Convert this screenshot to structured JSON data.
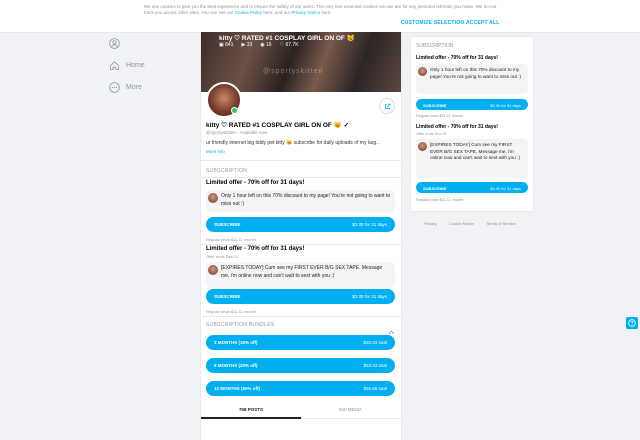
{
  "cookie": {
    "text_before": "We use cookies to give you the best experience and to ensure the safety of our users. The only non-essential cookies we use are for any personal referrals you make. We do not track you across other sites. You can see our ",
    "policy_link": "Cookie Policy",
    "text_mid": " here, and our ",
    "privacy_link": "Privacy Notice",
    "text_after": " here.",
    "customize_label": "CUSTOMIZE SELECTION",
    "accept_label": "ACCEPT ALL"
  },
  "sidebar": {
    "items": [
      {
        "label": "",
        "icon": "user-icon"
      },
      {
        "label": "Home",
        "icon": "home-icon"
      },
      {
        "label": "More",
        "icon": "more-icon"
      }
    ]
  },
  "profile": {
    "cover_title": "kitty ♡ RATED #1 COSPLAY GIRL ON OF 😼",
    "stats": [
      "841",
      "33",
      "16",
      "67.7K"
    ],
    "watermark": "@sportyskitten",
    "name": "kitty ♡ RATED #1 COSPLAY GIRL ON OF 😼 ✓",
    "handle": "@sportyskitten · Available now",
    "bio": "ur friendly internet big tiddy pet kitty 😼 subscribe for daily uploads of my larg..",
    "more_info": "More info"
  },
  "subscription": {
    "label": "SUBSCRIPTION",
    "offers": [
      {
        "title": "Limited offer - 70% off for 31 days!",
        "message": "Only 1 hour left on this 70% discount to my page! You're not going to want to miss out :)",
        "button_label": "SUBSCRIBE",
        "button_price": "$3.30 for 31 days",
        "regular": "Regular price $11.11 /month"
      },
      {
        "title": "Limited offer - 70% off for 31 days!",
        "ends": "Offer ends Dec 21",
        "message": "[EXPIRES TODAY] Cum see my FIRST EVER B/G SEX TAPE. Message me, i'm online now and can't wait to sext with you :)",
        "button_label": "SUBSCRIBE",
        "button_price": "$3.30 for 31 days",
        "regular": "Regular price $11.11 /month"
      }
    ]
  },
  "bundles": {
    "label": "SUBSCRIPTION BUNDLES",
    "items": [
      {
        "label": "3 MONTHS (15% off)",
        "price": "$28.33 total"
      },
      {
        "label": "6 MONTHS (20% off)",
        "price": "$53.33 total"
      },
      {
        "label": "12 MONTHS (50% off)",
        "price": "$66.66 total"
      }
    ]
  },
  "tabs": {
    "posts": "758 POSTS",
    "media": "840 MEDIA"
  },
  "right": {
    "label": "SUBSCRIPTION",
    "offers": [
      {
        "title": "Limited offer - 70% off for 31 days!",
        "message": "Only 1 hour left on this 70% discount to my page! You're not going to want to miss out :)",
        "button_label": "SUBSCRIBE",
        "button_price": "$3.30 for 31 days",
        "regular": "Regular price $11.11 /month"
      },
      {
        "title": "Limited offer - 70% off for 31 days!",
        "ends": "Offer ends Dec 21",
        "message": "[EXPIRES TODAY] Cum see my FIRST EVER B/G SEX TAPE. Message me, i'm online now and can't wait to sext with you :)",
        "button_label": "SUBSCRIBE",
        "button_price": "$3.30 for 31 days",
        "regular": "Regular price $11.11 /month"
      }
    ]
  },
  "footer": {
    "privacy": "Privacy",
    "cookie": "Cookie Notice",
    "terms": "Terms of Service"
  },
  "colors": {
    "accent": "#00aff0",
    "online": "#35c45a"
  }
}
